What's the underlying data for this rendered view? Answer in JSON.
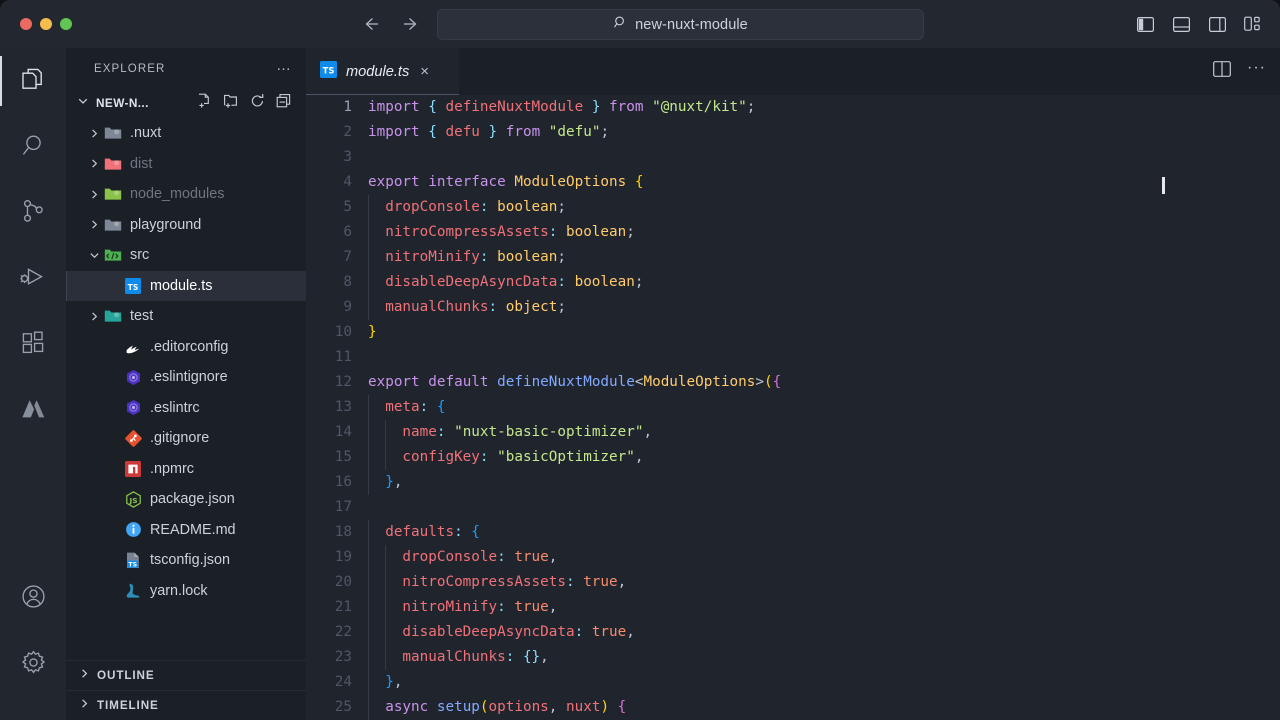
{
  "window": {
    "traffic_lights": [
      "close",
      "minimize",
      "maximize"
    ],
    "colors": {
      "close": "#ec6a5f",
      "minimize": "#f4bd4f",
      "maximize": "#61c554"
    }
  },
  "titlebar": {
    "back_label": "Go Back",
    "forward_label": "Go Forward",
    "search": {
      "value": "new-nuxt-module",
      "icon": "search-icon"
    },
    "layout_buttons": [
      {
        "name": "toggle-primary-sidebar",
        "label": "Toggle Primary Side Bar"
      },
      {
        "name": "toggle-panel",
        "label": "Toggle Panel"
      },
      {
        "name": "toggle-secondary-sidebar",
        "label": "Toggle Secondary Side Bar"
      },
      {
        "name": "customize-layout",
        "label": "Customize Layout"
      }
    ]
  },
  "activitybar": {
    "items": [
      {
        "name": "explorer",
        "icon": "files-icon",
        "active": true
      },
      {
        "name": "search",
        "icon": "search-icon",
        "active": false
      },
      {
        "name": "source-control",
        "icon": "source-control-icon",
        "active": false
      },
      {
        "name": "run-and-debug",
        "icon": "run-debug-icon",
        "active": false
      },
      {
        "name": "extensions",
        "icon": "extensions-icon",
        "active": false
      },
      {
        "name": "atlassian",
        "icon": "atlassian-icon",
        "active": false
      }
    ],
    "bottom": [
      {
        "name": "accounts",
        "icon": "account-icon"
      },
      {
        "name": "manage",
        "icon": "gear-icon"
      }
    ]
  },
  "sidebar": {
    "title": "EXPLORER",
    "more_actions": "…",
    "root": {
      "label": "NEW-N...",
      "expanded": true,
      "actions": [
        {
          "name": "new-file",
          "icon": "new-file-icon"
        },
        {
          "name": "new-folder",
          "icon": "new-folder-icon"
        },
        {
          "name": "refresh-explorer",
          "icon": "refresh-icon"
        },
        {
          "name": "collapse-folders",
          "icon": "collapse-all-icon"
        }
      ]
    },
    "tree": [
      {
        "label": ".nuxt",
        "type": "folder",
        "indent": 1,
        "expanded": false,
        "dim": false,
        "icon_color": "#7d8796"
      },
      {
        "label": "dist",
        "type": "folder",
        "indent": 1,
        "expanded": false,
        "dim": true,
        "icon_color": "#f07178"
      },
      {
        "label": "node_modules",
        "type": "folder",
        "indent": 1,
        "expanded": false,
        "dim": true,
        "icon_color": "#8bc34a"
      },
      {
        "label": "playground",
        "type": "folder",
        "indent": 1,
        "expanded": false,
        "dim": false,
        "icon_color": "#7d8796"
      },
      {
        "label": "src",
        "type": "folder-src",
        "indent": 1,
        "expanded": true,
        "dim": false,
        "icon_color": "#4caf50"
      },
      {
        "label": "module.ts",
        "type": "file-ts",
        "indent": 2,
        "selected": true,
        "dim": false,
        "icon_color": "#0288d1"
      },
      {
        "label": "test",
        "type": "folder",
        "indent": 1,
        "expanded": false,
        "dim": false,
        "icon_color": "#26a69a"
      },
      {
        "label": ".editorconfig",
        "type": "file-editorconfig",
        "indent": 2,
        "dim": false,
        "icon_color": "#ffffff"
      },
      {
        "label": ".eslintignore",
        "type": "file-eslint",
        "indent": 2,
        "dim": false,
        "icon_color": "#4b32c3"
      },
      {
        "label": ".eslintrc",
        "type": "file-eslint",
        "indent": 2,
        "dim": false,
        "icon_color": "#4b32c3"
      },
      {
        "label": ".gitignore",
        "type": "file-git",
        "indent": 2,
        "dim": false,
        "icon_color": "#e8512f"
      },
      {
        "label": ".npmrc",
        "type": "file-npm",
        "indent": 2,
        "dim": false,
        "icon_color": "#cb3837"
      },
      {
        "label": "package.json",
        "type": "file-node",
        "indent": 2,
        "dim": false,
        "icon_color": "#8bc34a"
      },
      {
        "label": "README.md",
        "type": "file-info",
        "indent": 2,
        "dim": false,
        "icon_color": "#42a5f5"
      },
      {
        "label": "tsconfig.json",
        "type": "file-tsconfig",
        "indent": 2,
        "dim": false,
        "icon_color": "#0288d1"
      },
      {
        "label": "yarn.lock",
        "type": "file-yarn",
        "indent": 2,
        "dim": false,
        "icon_color": "#2c8ebb"
      }
    ],
    "sections": [
      {
        "label": "OUTLINE",
        "expanded": false
      },
      {
        "label": "TIMELINE",
        "expanded": false
      }
    ]
  },
  "editor": {
    "tab": {
      "label": "module.ts",
      "icon": "typescript-icon",
      "preview_italic": true,
      "close_label": "×"
    },
    "actions": [
      {
        "name": "split-editor-right",
        "icon": "split-editor-icon"
      },
      {
        "name": "more-editor-actions",
        "icon": "ellipsis-icon",
        "label": "···"
      }
    ],
    "language": "TypeScript",
    "filename": "module.ts",
    "first_line": 1,
    "last_visible_line": 25,
    "lines": [
      {
        "n": 1,
        "tokens": [
          [
            "kw",
            "import"
          ],
          [
            "pun2",
            " "
          ],
          [
            "pun",
            "{"
          ],
          [
            "pun2",
            " "
          ],
          [
            "id",
            "defineNuxtModule"
          ],
          [
            "pun2",
            " "
          ],
          [
            "pun",
            "}"
          ],
          [
            "pun2",
            " "
          ],
          [
            "kw",
            "from"
          ],
          [
            "pun2",
            " "
          ],
          [
            "str",
            "\"@nuxt/kit\""
          ],
          [
            "pun2",
            ";"
          ]
        ]
      },
      {
        "n": 2,
        "tokens": [
          [
            "kw",
            "import"
          ],
          [
            "pun2",
            " "
          ],
          [
            "pun",
            "{"
          ],
          [
            "pun2",
            " "
          ],
          [
            "id",
            "defu"
          ],
          [
            "pun2",
            " "
          ],
          [
            "pun",
            "}"
          ],
          [
            "pun2",
            " "
          ],
          [
            "kw",
            "from"
          ],
          [
            "pun2",
            " "
          ],
          [
            "str",
            "\"defu\""
          ],
          [
            "pun2",
            ";"
          ]
        ]
      },
      {
        "n": 3,
        "tokens": []
      },
      {
        "n": 4,
        "tokens": [
          [
            "kw",
            "export"
          ],
          [
            "pun2",
            " "
          ],
          [
            "kw",
            "interface"
          ],
          [
            "pun2",
            " "
          ],
          [
            "typ",
            "ModuleOptions"
          ],
          [
            "pun2",
            " "
          ],
          [
            "brk1",
            "{"
          ]
        ]
      },
      {
        "n": 5,
        "indent": 1,
        "tokens": [
          [
            "id",
            "  dropConsole"
          ],
          [
            "pun",
            ":"
          ],
          [
            "pun2",
            " "
          ],
          [
            "typ",
            "boolean"
          ],
          [
            "pun2",
            ";"
          ]
        ]
      },
      {
        "n": 6,
        "indent": 1,
        "tokens": [
          [
            "id",
            "  nitroCompressAssets"
          ],
          [
            "pun",
            ":"
          ],
          [
            "pun2",
            " "
          ],
          [
            "typ",
            "boolean"
          ],
          [
            "pun2",
            ";"
          ]
        ]
      },
      {
        "n": 7,
        "indent": 1,
        "tokens": [
          [
            "id",
            "  nitroMinify"
          ],
          [
            "pun",
            ":"
          ],
          [
            "pun2",
            " "
          ],
          [
            "typ",
            "boolean"
          ],
          [
            "pun2",
            ";"
          ]
        ]
      },
      {
        "n": 8,
        "indent": 1,
        "tokens": [
          [
            "id",
            "  disableDeepAsyncData"
          ],
          [
            "pun",
            ":"
          ],
          [
            "pun2",
            " "
          ],
          [
            "typ",
            "boolean"
          ],
          [
            "pun2",
            ";"
          ]
        ]
      },
      {
        "n": 9,
        "indent": 1,
        "tokens": [
          [
            "id",
            "  manualChunks"
          ],
          [
            "pun",
            ":"
          ],
          [
            "pun2",
            " "
          ],
          [
            "typ",
            "object"
          ],
          [
            "pun2",
            ";"
          ]
        ]
      },
      {
        "n": 10,
        "tokens": [
          [
            "brk1",
            "}"
          ]
        ]
      },
      {
        "n": 11,
        "tokens": []
      },
      {
        "n": 12,
        "tokens": [
          [
            "kw",
            "export"
          ],
          [
            "pun2",
            " "
          ],
          [
            "kw",
            "default"
          ],
          [
            "pun2",
            " "
          ],
          [
            "fn",
            "defineNuxtModule"
          ],
          [
            "pun2",
            "<"
          ],
          [
            "typ",
            "ModuleOptions"
          ],
          [
            "pun2",
            ">"
          ],
          [
            "brk1",
            "("
          ],
          [
            "brk2",
            "{"
          ]
        ]
      },
      {
        "n": 13,
        "indent": 1,
        "tokens": [
          [
            "id",
            "  meta"
          ],
          [
            "pun",
            ":"
          ],
          [
            "pun2",
            " "
          ],
          [
            "brk3",
            "{"
          ]
        ]
      },
      {
        "n": 14,
        "indent": 2,
        "tokens": [
          [
            "id",
            "    name"
          ],
          [
            "pun",
            ":"
          ],
          [
            "pun2",
            " "
          ],
          [
            "str",
            "\"nuxt-basic-optimizer\""
          ],
          [
            "pun2",
            ","
          ]
        ]
      },
      {
        "n": 15,
        "indent": 2,
        "tokens": [
          [
            "id",
            "    configKey"
          ],
          [
            "pun",
            ":"
          ],
          [
            "pun2",
            " "
          ],
          [
            "str",
            "\"basicOptimizer\""
          ],
          [
            "pun2",
            ","
          ]
        ]
      },
      {
        "n": 16,
        "indent": 1,
        "tokens": [
          [
            "brk3",
            "  }"
          ],
          [
            "pun2",
            ","
          ]
        ]
      },
      {
        "n": 17,
        "tokens": []
      },
      {
        "n": 18,
        "indent": 1,
        "tokens": [
          [
            "id",
            "  defaults"
          ],
          [
            "pun",
            ":"
          ],
          [
            "pun2",
            " "
          ],
          [
            "brk3",
            "{"
          ]
        ]
      },
      {
        "n": 19,
        "indent": 2,
        "tokens": [
          [
            "id",
            "    dropConsole"
          ],
          [
            "pun",
            ":"
          ],
          [
            "pun2",
            " "
          ],
          [
            "bool",
            "true"
          ],
          [
            "pun2",
            ","
          ]
        ]
      },
      {
        "n": 20,
        "indent": 2,
        "tokens": [
          [
            "id",
            "    nitroCompressAssets"
          ],
          [
            "pun",
            ":"
          ],
          [
            "pun2",
            " "
          ],
          [
            "bool",
            "true"
          ],
          [
            "pun2",
            ","
          ]
        ]
      },
      {
        "n": 21,
        "indent": 2,
        "tokens": [
          [
            "id",
            "    nitroMinify"
          ],
          [
            "pun",
            ":"
          ],
          [
            "pun2",
            " "
          ],
          [
            "bool",
            "true"
          ],
          [
            "pun2",
            ","
          ]
        ]
      },
      {
        "n": 22,
        "indent": 2,
        "tokens": [
          [
            "id",
            "    disableDeepAsyncData"
          ],
          [
            "pun",
            ":"
          ],
          [
            "pun2",
            " "
          ],
          [
            "bool",
            "true"
          ],
          [
            "pun2",
            ","
          ]
        ]
      },
      {
        "n": 23,
        "indent": 2,
        "tokens": [
          [
            "id",
            "    manualChunks"
          ],
          [
            "pun",
            ":"
          ],
          [
            "pun2",
            " "
          ],
          [
            "pun",
            "{}"
          ],
          [
            "pun2",
            ","
          ]
        ]
      },
      {
        "n": 24,
        "indent": 1,
        "tokens": [
          [
            "brk3",
            "  }"
          ],
          [
            "pun2",
            ","
          ]
        ]
      },
      {
        "n": 25,
        "indent": 1,
        "tokens": [
          [
            "kw",
            "  async"
          ],
          [
            "pun2",
            " "
          ],
          [
            "fn",
            "setup"
          ],
          [
            "brk1",
            "("
          ],
          [
            "id",
            "options"
          ],
          [
            "pun2",
            ", "
          ],
          [
            "id",
            "nuxt"
          ],
          [
            "brk1",
            ")"
          ],
          [
            "pun2",
            " "
          ],
          [
            "brk2",
            "{"
          ]
        ]
      }
    ]
  },
  "theme": {
    "editor_bg": "#20242d",
    "sidebar_bg": "#1b1f26",
    "activitybar_bg": "#22262f",
    "titlebar_bg": "#23272f",
    "accent_selected": "#2a2f39",
    "keyword": "#c792ea",
    "string": "#c3e88d",
    "identifier": "#f07178",
    "type": "#ffcb6b",
    "function": "#82aaff",
    "boolean": "#f78c6c"
  }
}
